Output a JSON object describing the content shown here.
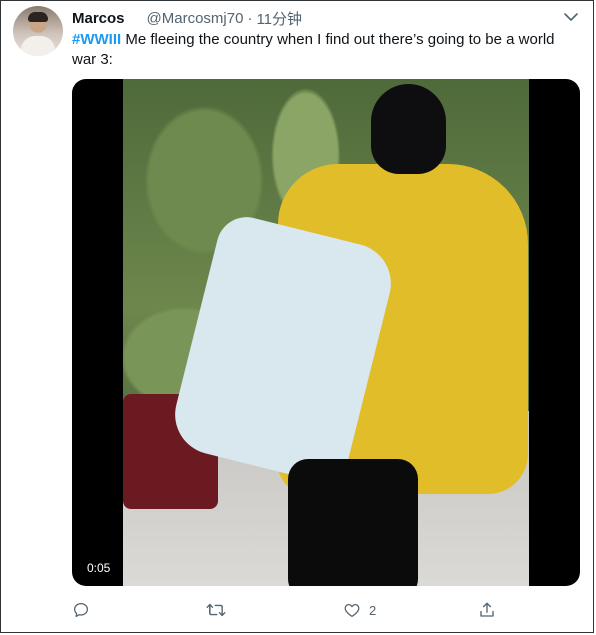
{
  "tweet": {
    "author_name": "Marcos",
    "author_handle": "@Marcosmj70",
    "separator": "·",
    "time": "11分钟",
    "hashtag": "#WWIII",
    "text": " Me fleeing the country when I find out there’s going to be a world war 3:",
    "video_duration": "0:05"
  },
  "actions": {
    "reply_count": "",
    "retweet_count": "",
    "like_count": "2",
    "share_count": ""
  },
  "icons": {
    "more": "chevron-down-icon",
    "reply": "reply-icon",
    "retweet": "retweet-icon",
    "like": "heart-icon",
    "share": "share-icon"
  },
  "colors": {
    "accent": "#1d9bf0",
    "secondary_text": "#536471",
    "primary_text": "#0f1419"
  }
}
